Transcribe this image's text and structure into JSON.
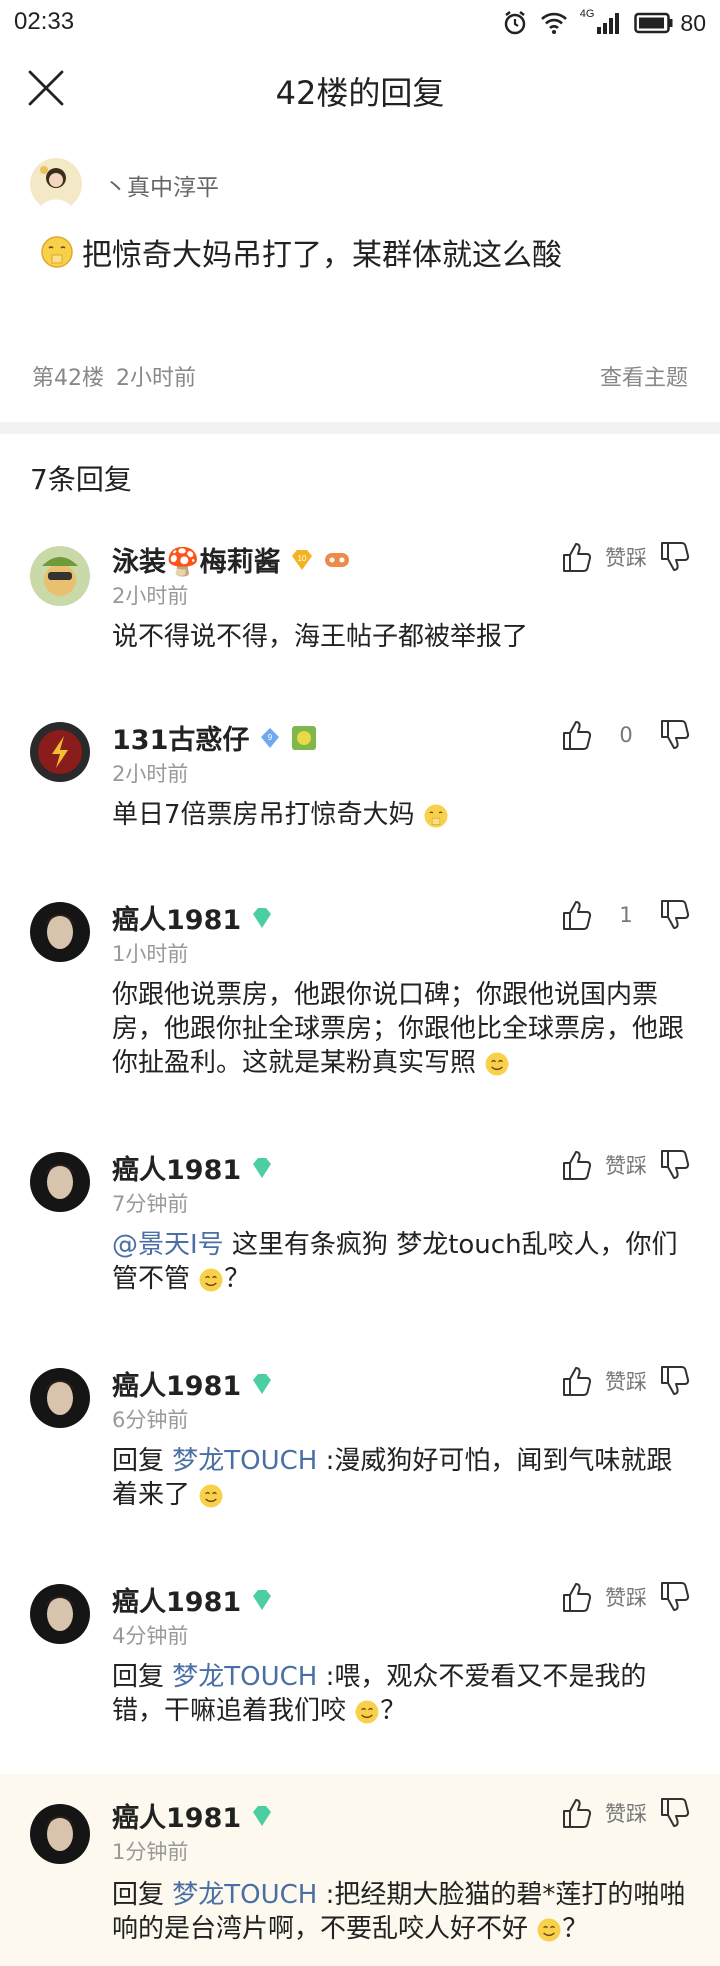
{
  "status": {
    "time": "02:33",
    "network": "4G",
    "battery": "80"
  },
  "nav": {
    "title": "42楼的回复"
  },
  "post": {
    "author": "丶真中淳平",
    "content": "把惊奇大妈吊打了，某群体就这么酸",
    "floor": "第42楼",
    "time": "2小时前",
    "view_topic": "查看主题"
  },
  "reply_count": "7条回复",
  "replies": [
    {
      "name": "泳装🍄梅莉酱",
      "time": "2小时前",
      "count": "赞踩",
      "level": "10",
      "body": "说不得说不得，海王帖子都被举报了"
    },
    {
      "name": "131古惑仔",
      "time": "2小时前",
      "count": "0",
      "level": "9",
      "body": "单日7倍票房吊打惊奇大妈"
    },
    {
      "name": "癌人1981",
      "time": "1小时前",
      "count": "1",
      "body": "你跟他说票房，他跟你说口碑；你跟他说国内票房，他跟你扯全球票房；你跟他比全球票房，他跟你扯盈利。这就是某粉真实写照"
    },
    {
      "name": "癌人1981",
      "time": "7分钟前",
      "count": "赞踩",
      "mention": "@景天I号",
      "body": " 这里有条疯狗 梦龙touch乱咬人，你们管不管",
      "tail": "？"
    },
    {
      "name": "癌人1981",
      "time": "6分钟前",
      "count": "赞踩",
      "prefix": "回复 ",
      "mention": "梦龙TOUCH",
      "body": " :漫威狗好可怕，闻到气味就跟着来了"
    },
    {
      "name": "癌人1981",
      "time": "4分钟前",
      "count": "赞踩",
      "prefix": "回复 ",
      "mention": "梦龙TOUCH",
      "body": " :喂，观众不爱看又不是我的错，干嘛追着我们咬",
      "tail": "？"
    },
    {
      "name": "癌人1981",
      "time": "1分钟前",
      "count": "赞踩",
      "prefix": "回复 ",
      "mention": "梦龙TOUCH",
      "body": " :把经期大脸猫的碧*莲打的啪啪响的是台湾片啊，不要乱咬人好不好",
      "tail": "？"
    }
  ],
  "colors": {
    "mention": "#4a6fa5",
    "highlight_bg": "#fdf9ee",
    "divider": "#f2f2f2"
  }
}
